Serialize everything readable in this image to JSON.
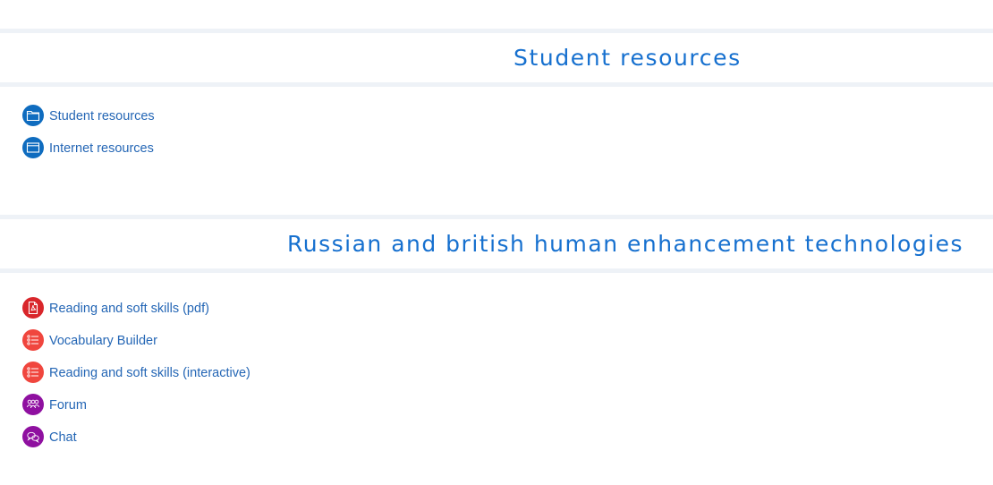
{
  "sections": [
    {
      "title": "Student resources",
      "activities": [
        {
          "label": "Student resources",
          "icon": "folder-icon",
          "color": "#0f6cbf"
        },
        {
          "label": "Internet resources",
          "icon": "browser-window-icon",
          "color": "#0f6cbf"
        }
      ]
    },
    {
      "title": "Russian and british human enhancement technologies",
      "activities": [
        {
          "label": "Reading and soft skills (pdf)",
          "icon": "pdf-file-icon",
          "color": "#d9262b"
        },
        {
          "label": "Vocabulary Builder",
          "icon": "quiz-list-icon",
          "color": "#f0463e"
        },
        {
          "label": "Reading and soft skills (interactive)",
          "icon": "quiz-list-icon",
          "color": "#f0463e"
        },
        {
          "label": "Forum",
          "icon": "forum-people-icon",
          "color": "#8f10a0"
        },
        {
          "label": "Chat",
          "icon": "chat-bubbles-icon",
          "color": "#8f10a0"
        }
      ]
    }
  ]
}
